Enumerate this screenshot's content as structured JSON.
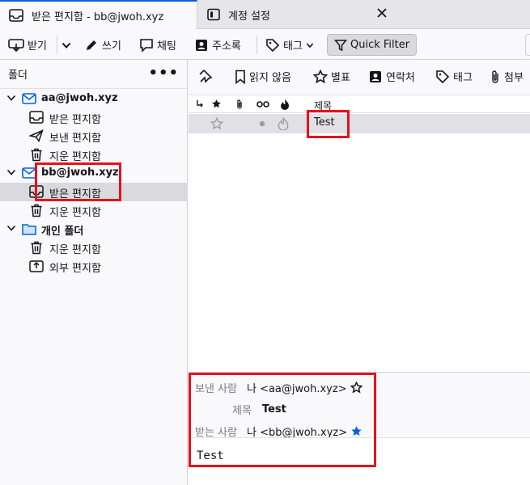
{
  "tabs": [
    {
      "label": "받은 편지함 - bb@jwoh.xyz",
      "icon": "inbox-icon"
    },
    {
      "label": "계정 설정",
      "icon": "settings-icon"
    }
  ],
  "toolbar": {
    "get_messages": "받기",
    "write": "쓰기",
    "chat": "채팅",
    "address_book": "주소록",
    "tag": "태그",
    "quick_filter": "Quick Filter"
  },
  "folder_pane": {
    "title": "폴더",
    "more": "•••",
    "accounts": [
      {
        "name": "aa@jwoh.xyz",
        "folders": [
          "받은 편지함",
          "보낸 편지함",
          "지운 편지함"
        ]
      },
      {
        "name": "bb@jwoh.xyz",
        "folders": [
          "받은 편지함",
          "지운 편지함"
        ],
        "selected_folder": "받은 편지함"
      },
      {
        "name": "개인 폴더",
        "folders": [
          "지운 편지함",
          "외부 편지함"
        ]
      }
    ]
  },
  "quick_filter_bar": {
    "unread": "읽지 않음",
    "starred": "별표",
    "contacts": "연락처",
    "tags": "태그",
    "attachments": "첨부"
  },
  "message_list": {
    "columns": {
      "subject": "제목"
    },
    "rows": [
      {
        "subject": "Test",
        "starred": false
      }
    ]
  },
  "message_header": {
    "from_label": "보낸 사람",
    "from_value": "나 <aa@jwoh.xyz>",
    "subject_label": "제목",
    "subject_value": "Test",
    "to_label": "받는 사람",
    "to_value": "나 <bb@jwoh.xyz>"
  },
  "message_body": "Test",
  "colors": {
    "accent": "#0061e0",
    "annotation": "#e8101c",
    "selected": "#dadade"
  }
}
